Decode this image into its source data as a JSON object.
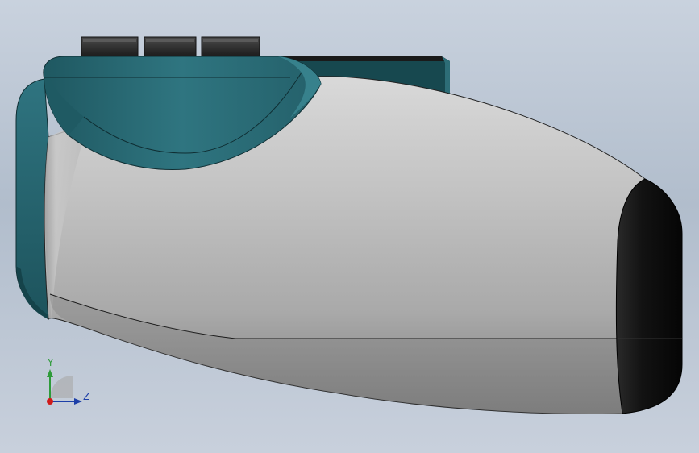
{
  "viewport": {
    "background_top": "#c9d2de",
    "background_bottom": "#c8d0dc"
  },
  "model": {
    "shell_color": "#b8b8b8",
    "accent_color": "#2b6670",
    "nose_color": "#111111",
    "connector_color": "#2a2a2a"
  },
  "triad": {
    "y_label": "Y",
    "z_label": "Z",
    "y_color": "#2e9b3a",
    "z_color": "#1d3fa8",
    "x_color": "#d01a1a"
  }
}
